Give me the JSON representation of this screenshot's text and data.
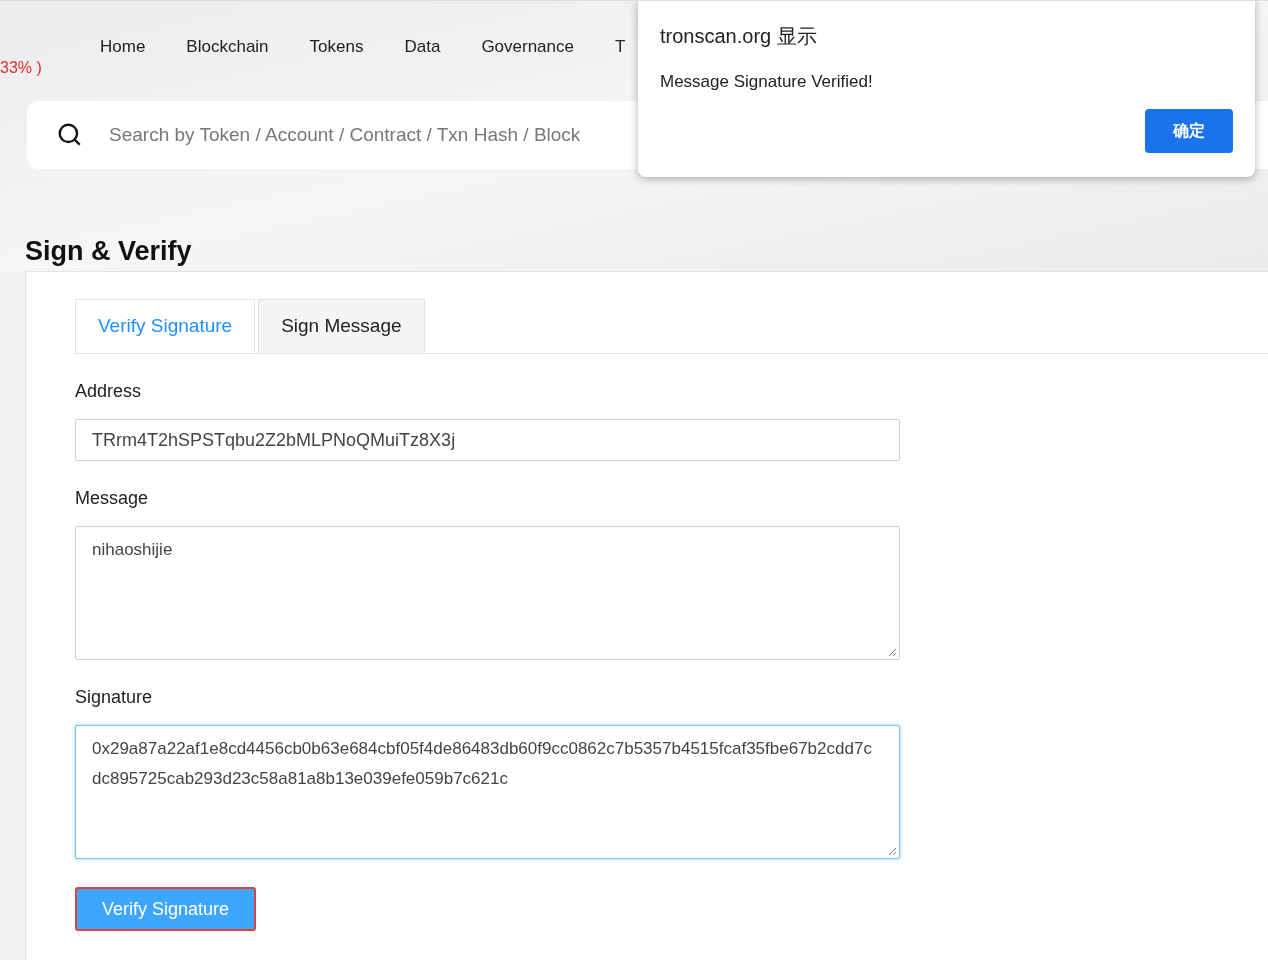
{
  "ticker": "33% )",
  "nav": [
    "Home",
    "Blockchain",
    "Tokens",
    "Data",
    "Governance",
    "T"
  ],
  "search": {
    "placeholder": "Search by Token / Account / Contract / Txn Hash / Block"
  },
  "page_title": "Sign & Verify",
  "tabs": [
    {
      "label": "Verify Signature",
      "selected": true
    },
    {
      "label": "Sign Message",
      "selected": false
    }
  ],
  "fields": [
    {
      "label": "Address",
      "kind": "input",
      "value": "TRrm4T2hSPSTqbu2Z2bMLPNoQMuiTz8X3j",
      "focused": false
    },
    {
      "label": "Message",
      "kind": "textarea",
      "value": "nihaoshijie",
      "focused": false
    },
    {
      "label": "Signature",
      "kind": "textarea",
      "value": "0x29a87a22af1e8cd4456cb0b63e684cbf05f4de86483db60f9cc0862c7b5357b4515fcaf35fbe67b2cdd7cdc895725cab293d23c58a81a8b13e039efe059b7c621c",
      "focused": true
    }
  ],
  "submit_button": "Verify Signature",
  "dialog": {
    "title": "tronscan.org 显示",
    "message": "Message Signature Verified!",
    "button": "确定"
  }
}
